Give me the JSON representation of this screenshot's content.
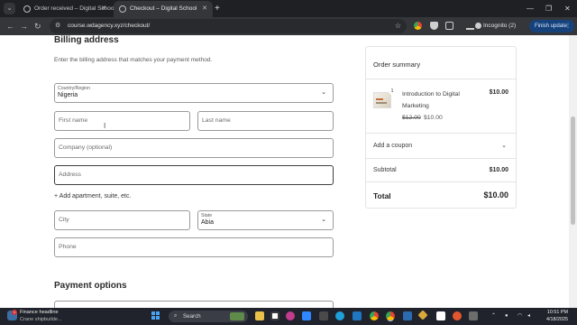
{
  "browser": {
    "tabs": [
      {
        "title": "Order received – Digital School",
        "active": false
      },
      {
        "title": "Checkout – Digital School",
        "active": true
      }
    ],
    "url": "course.wdagency.xyz/checkout/",
    "profile_label": "Incognito (2)",
    "update_button": "Finish update"
  },
  "billing": {
    "heading": "Billing address",
    "subtitle": "Enter the billing address that matches your payment method.",
    "country": {
      "label": "Country/Region",
      "value": "Nigeria"
    },
    "first_name_placeholder": "First name",
    "last_name_placeholder": "Last name",
    "company_placeholder": "Company (optional)",
    "address_placeholder": "Address",
    "add_apartment": "+ Add apartment, suite, etc.",
    "city_placeholder": "City",
    "state": {
      "label": "State",
      "value": "Abia"
    },
    "phone_placeholder": "Phone"
  },
  "payment": {
    "heading": "Payment options"
  },
  "order_summary": {
    "title": "Order summary",
    "item": {
      "name": "Introduction to Digital Marketing",
      "price": "$10.00",
      "original_price": "$12.00",
      "sale_price": "$10.00",
      "quantity": "1"
    },
    "coupon_label": "Add a coupon",
    "subtotal_label": "Subtotal",
    "subtotal_value": "$10.00",
    "total_label": "Total",
    "total_value": "$10.00"
  },
  "taskbar": {
    "news_title": "Finance headline",
    "news_subtitle": "Crane shipbuilde...",
    "news_badge": "1",
    "search_label": "Search",
    "time": "10:51 PM",
    "date": "4/18/2025"
  },
  "colors": {
    "accent": "#16427c",
    "field_border": "#9a9a9a",
    "taskbar_bg": "#20232b"
  }
}
